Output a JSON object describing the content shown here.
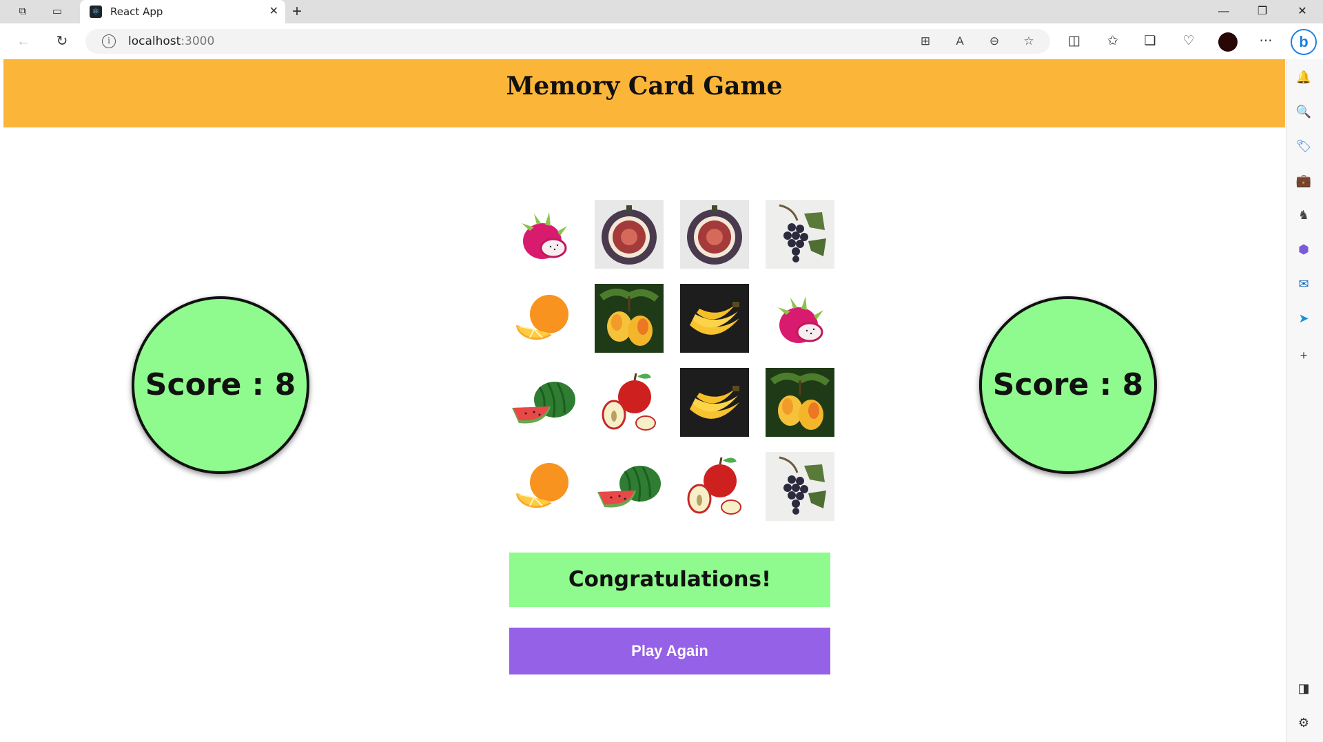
{
  "browser": {
    "tab_title": "React App",
    "url_host": "localhost",
    "url_port": ":3000"
  },
  "page": {
    "title": "Memory Card Game",
    "player1_score": "Score : 8",
    "player2_score": "Score : 8",
    "message": "Congratulations!",
    "play_again_label": "Play Again"
  },
  "colors": {
    "header": "#fbb63a",
    "score_circle": "#8ffa8d",
    "congrats_banner": "#8ffa8d",
    "play_again_button": "#9561e6"
  },
  "cards": [
    [
      "dragon-fruit",
      "fig",
      "fig",
      "grapes"
    ],
    [
      "orange",
      "mango",
      "banana",
      "dragon-fruit"
    ],
    [
      "watermelon",
      "apple",
      "banana",
      "mango"
    ],
    [
      "orange",
      "watermelon",
      "apple",
      "grapes"
    ]
  ]
}
